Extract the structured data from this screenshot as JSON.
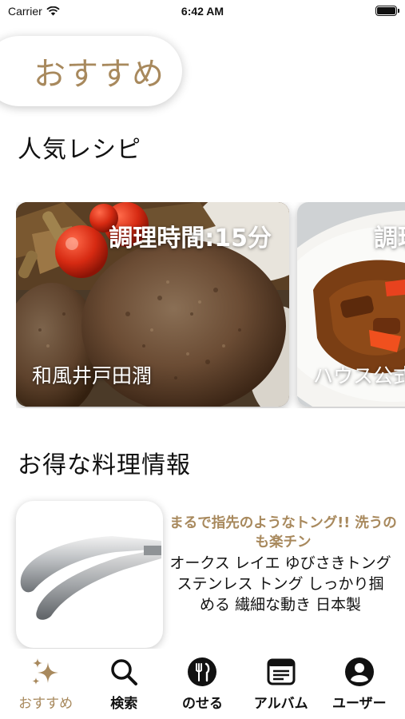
{
  "status_bar": {
    "carrier": "Carrier",
    "time": "6:42 AM"
  },
  "header": {
    "title": "おすすめ"
  },
  "popular": {
    "title": "人気レシピ",
    "recipes": [
      {
        "cook_time": "調理時間:15分",
        "name": "和風井戸田潤"
      },
      {
        "cook_time": "調理時間",
        "name": "ハウス公式"
      }
    ]
  },
  "deals": {
    "title": "お得な料理情報",
    "item": {
      "headline": "まるで指先のようなトング!! 洗うのも楽チン",
      "description": "オークス レイエ ゆびさきトング ステンレス トング しっかり掴める 繊細な動き 日本製"
    }
  },
  "tab_bar": {
    "tabs": [
      {
        "label": "おすすめ",
        "icon": "sparkles-icon",
        "active": true
      },
      {
        "label": "検索",
        "icon": "search-icon"
      },
      {
        "label": "のせる",
        "icon": "fork-knife-icon"
      },
      {
        "label": "アルバム",
        "icon": "album-icon"
      },
      {
        "label": "ユーザー",
        "icon": "user-icon"
      }
    ]
  },
  "colors": {
    "accent": "#a8895d",
    "text": "#111111"
  }
}
